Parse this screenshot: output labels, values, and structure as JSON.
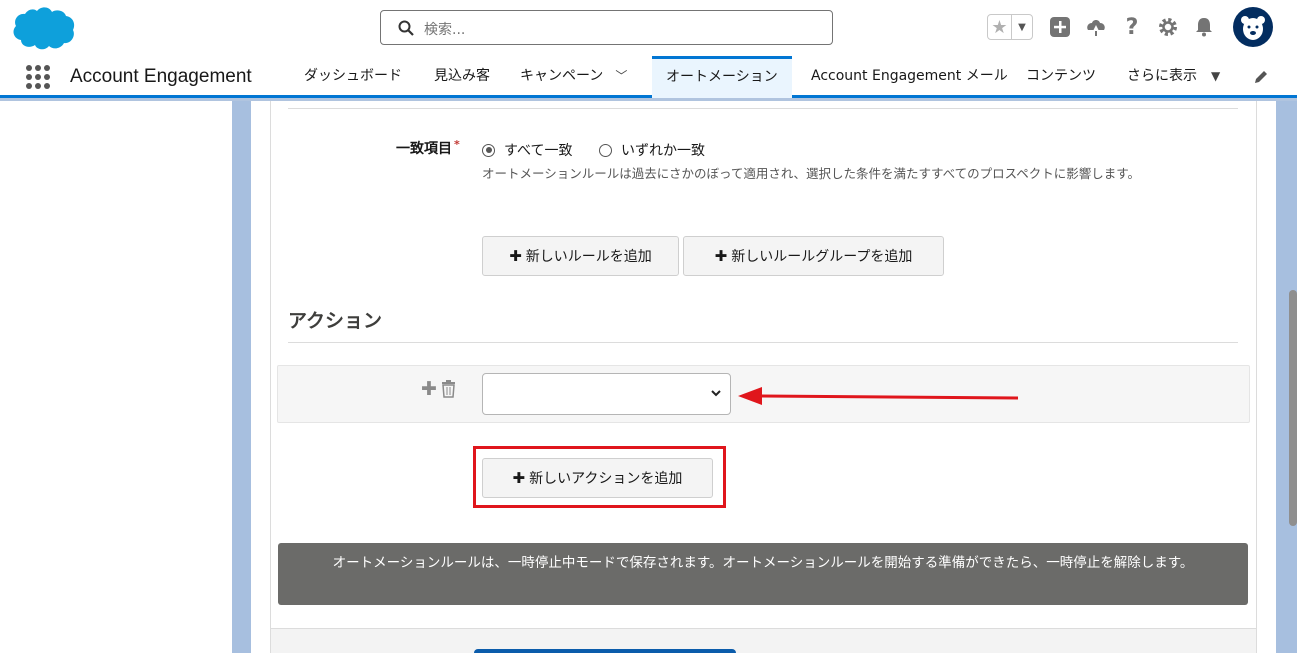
{
  "header": {
    "logo": "salesforce-cloud-logo",
    "search_placeholder": "検索...",
    "icons": [
      "favorites-star-icon",
      "add-icon",
      "trailhead-icon",
      "help-icon",
      "setup-gear-icon",
      "notifications-bell-icon",
      "user-avatar"
    ]
  },
  "nav": {
    "app_name": "Account Engagement",
    "tabs": [
      {
        "label": "ダッシュボード"
      },
      {
        "label": "見込み客"
      },
      {
        "label": "キャンペーン"
      },
      {
        "label": "オートメーション",
        "active": true
      },
      {
        "label": "Account Engagement メール"
      },
      {
        "label": "コンテンツ"
      },
      {
        "label": "さらに表示"
      }
    ]
  },
  "rules": {
    "match_label": "一致項目",
    "required_mark": "*",
    "option_all": "すべて一致",
    "option_any": "いずれか一致",
    "selected": "すべて一致",
    "help_text": "オートメーションルールは過去にさかのぼって適用され、選択した条件を満たすすべてのプロスペクトに影響します。",
    "add_rule": "新しいルールを追加",
    "add_rule_group": "新しいルールグループを追加"
  },
  "actions": {
    "title": "アクション",
    "select_value": "",
    "add_action": "新しいアクションを追加"
  },
  "notice": {
    "text": "オートメーションルールは、一時停止中モードで保存されます。オートメーションルールを開始する準備ができたら、一時停止を解除します。"
  },
  "colors": {
    "brand": "#0176d3",
    "annotation_red": "#e0161c",
    "notice_bg": "#6b6b69"
  }
}
